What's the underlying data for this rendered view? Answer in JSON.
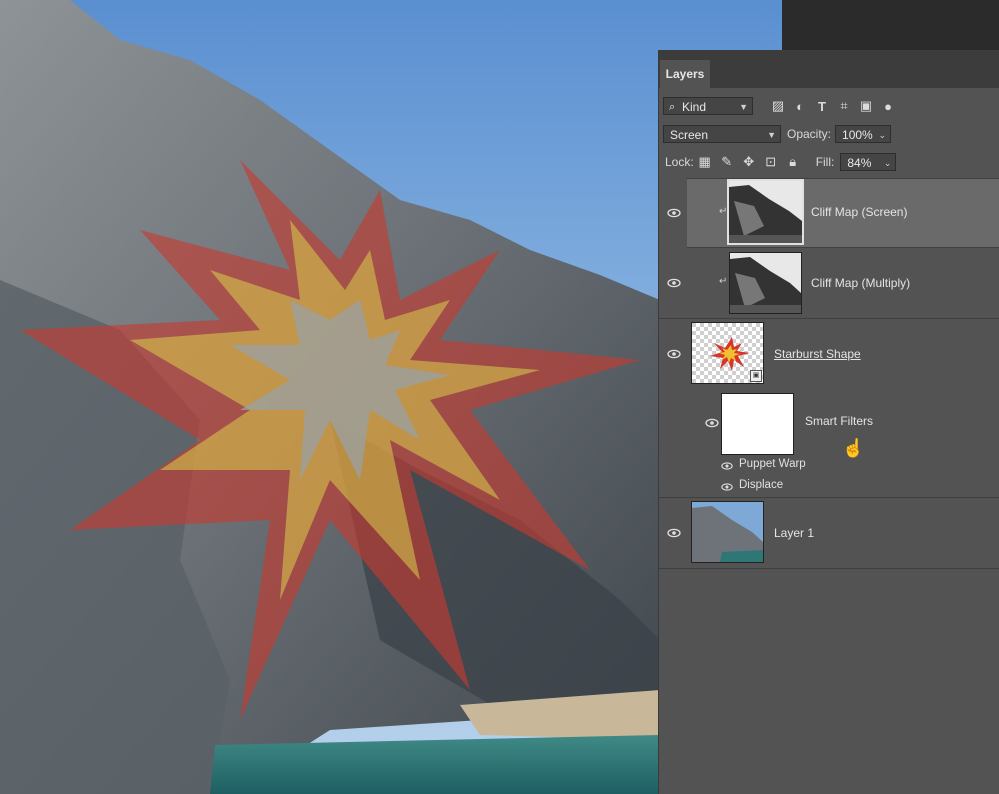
{
  "panel": {
    "tab_label": "Layers",
    "filter": {
      "kind_label": "Kind",
      "filter_icons": [
        "image-filter-icon",
        "adjustment-filter-icon",
        "type-filter-icon",
        "shape-filter-icon",
        "smartobject-filter-icon",
        "filter-toggle-icon"
      ]
    },
    "blend": {
      "mode": "Screen",
      "opacity_label": "Opacity:",
      "opacity_value": "100%"
    },
    "lock": {
      "label": "Lock:",
      "fill_label": "Fill:",
      "fill_value": "84%"
    }
  },
  "layers": [
    {
      "name": "Cliff Map (Screen)",
      "selected": true
    },
    {
      "name": "Cliff Map (Multiply)",
      "selected": false
    },
    {
      "name": "Starburst Shape",
      "selected": false,
      "smart_filters": {
        "label": "Smart Filters",
        "items": [
          "Puppet Warp",
          "Displace"
        ]
      }
    },
    {
      "name": "Layer 1",
      "selected": false
    }
  ],
  "colors": {
    "panel_bg": "#535353",
    "selected_row": "#6a6a6a",
    "tab_bar": "#3c3c3c"
  }
}
